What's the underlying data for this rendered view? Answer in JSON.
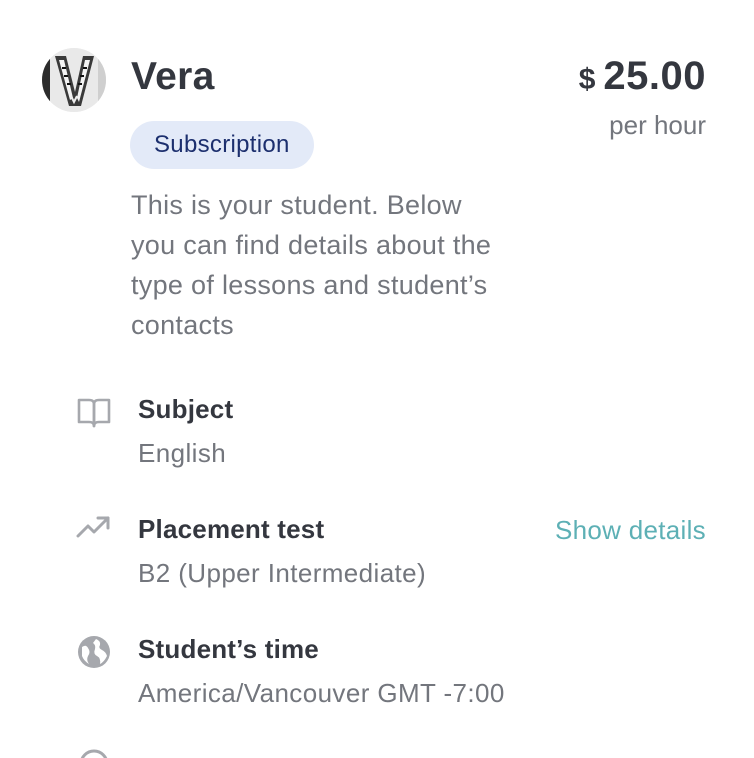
{
  "student": {
    "name": "Vera",
    "badge": "Subscription",
    "description": "This is your student. Below you can find details about the type of lessons and student’s contacts"
  },
  "price": {
    "currency": "$",
    "amount": "25.00",
    "unit": "per hour"
  },
  "details": {
    "subject": {
      "icon": "book-icon",
      "title": "Subject",
      "value": "English"
    },
    "placement": {
      "icon": "trending-up-icon",
      "title": "Placement test",
      "value": "B2 (Upper Intermediate)",
      "link": "Show details"
    },
    "time": {
      "icon": "globe-icon",
      "title": "Student’s time",
      "value": "America/Vancouver GMT -7:00"
    }
  },
  "colors": {
    "accent": "#5db0b5",
    "badge_bg": "#e3eaf8",
    "badge_text": "#1c2f6e",
    "icon": "#a6a8ad"
  }
}
